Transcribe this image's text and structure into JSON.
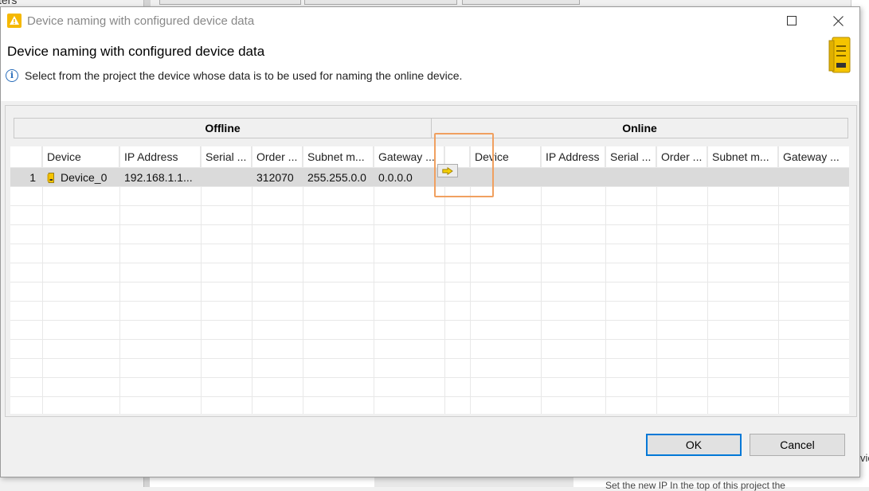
{
  "background": {
    "left_text": "ters",
    "right_text": "vic",
    "bottom_text": "Set the new IP In the top of this project the"
  },
  "dialog": {
    "title": "Device naming with configured device data",
    "heading": "Device naming with configured device data",
    "info": "Select from the project the device whose data is to be used for naming the online device."
  },
  "offline": {
    "header": "Offline",
    "columns": [
      "Device",
      "IP Address",
      "Serial ...",
      "Order ...",
      "Subnet m...",
      "Gateway ..."
    ],
    "rows": [
      {
        "num": "1",
        "device": "Device_0",
        "ip": "192.168.1.1...",
        "serial": "",
        "order": "312070",
        "subnet": "255.255.0.0",
        "gateway": "0.0.0.0"
      }
    ]
  },
  "online": {
    "header": "Online",
    "columns": [
      "Device",
      "IP Address",
      "Serial ...",
      "Order ...",
      "Subnet m...",
      "Gateway ..."
    ]
  },
  "icons": {
    "assign": "arrow-right-icon",
    "info": "info-icon",
    "app": "warning-app-icon",
    "device": "device-icon"
  },
  "buttons": {
    "ok": "OK",
    "cancel": "Cancel"
  },
  "colors": {
    "accent": "#0078d7",
    "highlight": "#f0a060",
    "device_yellow": "#f5c400"
  }
}
